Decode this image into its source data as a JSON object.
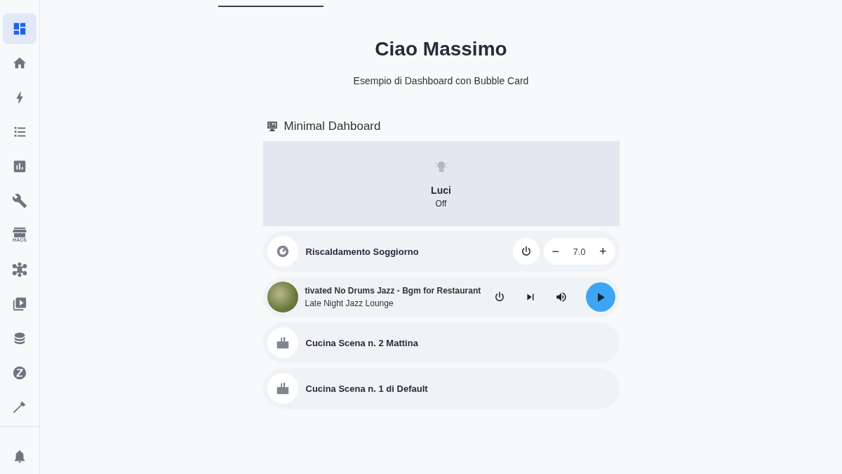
{
  "sidebar": {
    "items": [
      {
        "kind": "dashboard",
        "selected": true
      },
      {
        "kind": "home",
        "selected": false
      },
      {
        "kind": "bolt",
        "selected": false
      },
      {
        "kind": "list",
        "selected": false
      },
      {
        "kind": "chart",
        "selected": false
      },
      {
        "kind": "wrench",
        "selected": false
      },
      {
        "kind": "store",
        "caption": "HACS",
        "selected": false
      },
      {
        "kind": "hub",
        "selected": false
      },
      {
        "kind": "media",
        "selected": false
      },
      {
        "kind": "database",
        "selected": false
      },
      {
        "kind": "zwave",
        "selected": false
      },
      {
        "kind": "hammer",
        "selected": false
      }
    ]
  },
  "header": {
    "title": "Ciao Massimo",
    "subtitle": "Esempio di Dashboard con Bubble Card"
  },
  "section": {
    "title": "Minimal Dahboard",
    "light": {
      "name": "Luci",
      "state": "Off",
      "on": false
    },
    "rows": [
      {
        "kind": "thermostat",
        "name": "Riscaldamento Soggiorno",
        "minus": "−",
        "value": "7.0",
        "plus": "+"
      },
      {
        "kind": "media",
        "title": "tivated No Drums Jazz - Bgm for Restaurant",
        "artist": "Late Night Jazz Lounge"
      },
      {
        "kind": "scene",
        "name": "Cucina Scena n. 2 Mattina"
      },
      {
        "kind": "scene",
        "name": "Cucina Scena n. 1 di Default"
      }
    ]
  }
}
